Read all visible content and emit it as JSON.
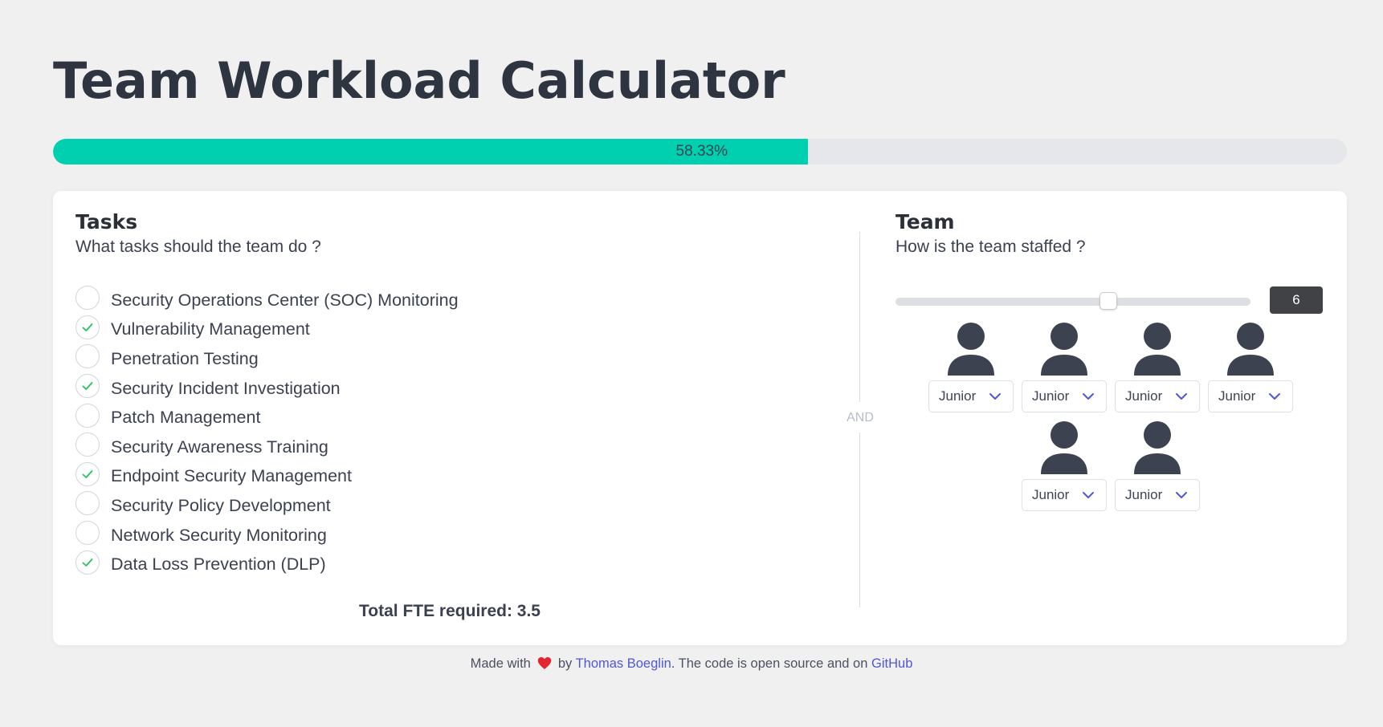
{
  "page": {
    "title": "Team Workload Calculator"
  },
  "progress": {
    "label": "58.33%",
    "fraction": 0.5833,
    "color": "#00cfb0"
  },
  "tasks": {
    "heading": "Tasks",
    "subheading": "What tasks should the team do ?",
    "items": [
      {
        "label": "Security Operations Center (SOC) Monitoring",
        "checked": false
      },
      {
        "label": "Vulnerability Management",
        "checked": true
      },
      {
        "label": "Penetration Testing",
        "checked": false
      },
      {
        "label": "Security Incident Investigation",
        "checked": true
      },
      {
        "label": "Patch Management",
        "checked": false
      },
      {
        "label": "Security Awareness Training",
        "checked": false
      },
      {
        "label": "Endpoint Security Management",
        "checked": true
      },
      {
        "label": "Security Policy Development",
        "checked": false
      },
      {
        "label": "Network Security Monitoring",
        "checked": false
      },
      {
        "label": "Data Loss Prevention (DLP)",
        "checked": true
      }
    ],
    "total": "Total FTE required: 3.5"
  },
  "divider": {
    "label": "AND"
  },
  "team": {
    "heading": "Team",
    "subheading": "How is the team staffed ?",
    "size": "6",
    "slider_fraction": 0.6,
    "members": [
      {
        "role": "Junior",
        "icon": "person-icon"
      },
      {
        "role": "Junior",
        "icon": "person-icon"
      },
      {
        "role": "Junior",
        "icon": "person-icon"
      },
      {
        "role": "Junior",
        "icon": "person-icon"
      },
      {
        "role": "Junior",
        "icon": "person-icon"
      },
      {
        "role": "Junior",
        "icon": "person-icon"
      }
    ]
  },
  "footer": {
    "made_with": "Made with",
    "heart_icon": "heart-icon",
    "by": "by",
    "author": "Thomas Boeglin",
    "middle": ". The code is open source and on",
    "repo_link": "GitHub"
  },
  "colors": {
    "accent": "#00cfb0",
    "check": "#22c55e",
    "link": "#4f57d6",
    "person": "#3d4250"
  }
}
